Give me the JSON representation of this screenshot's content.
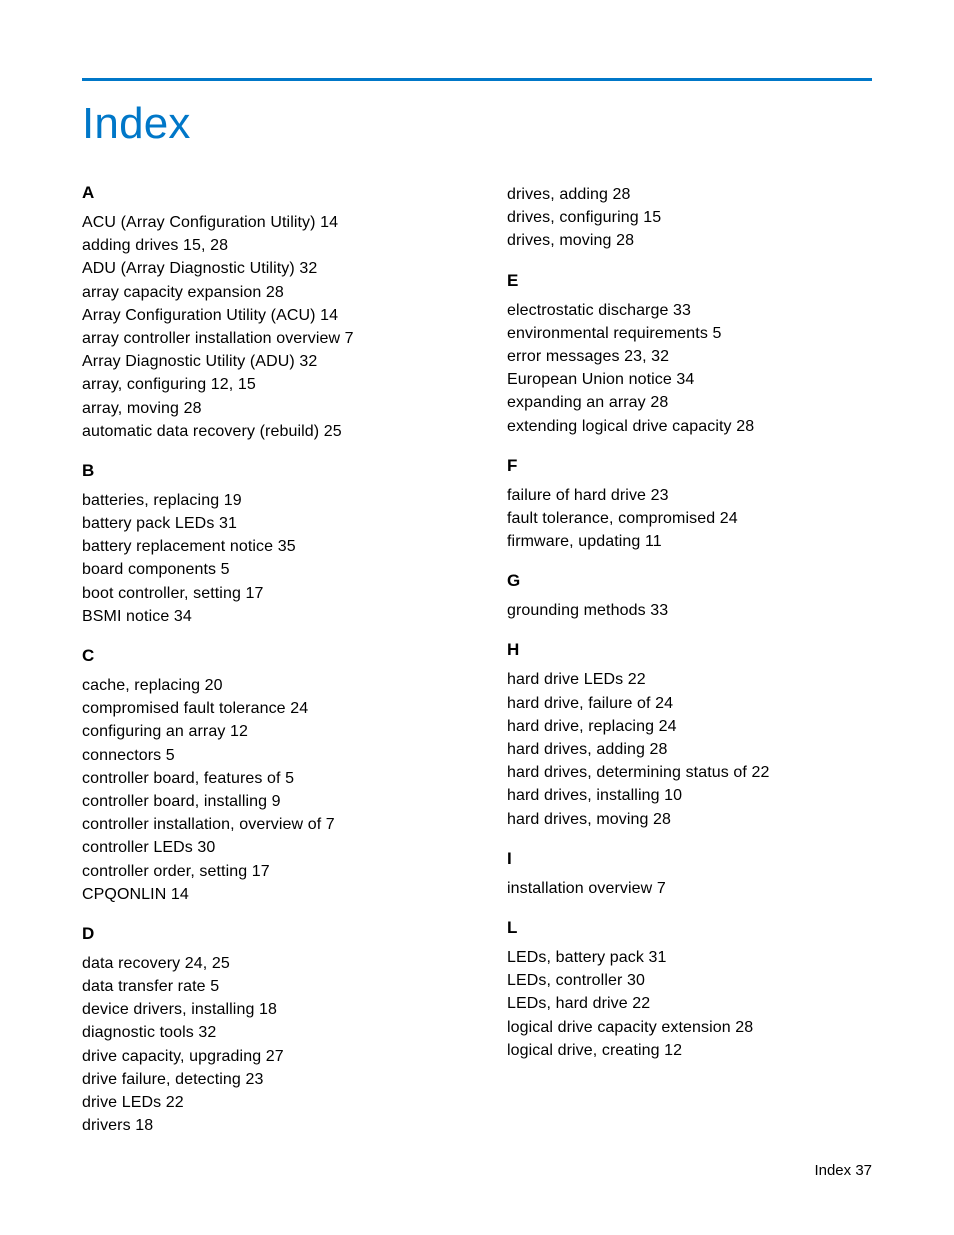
{
  "title": "Index",
  "footer": {
    "label": "Index",
    "page": "37"
  },
  "left": [
    {
      "head": "A",
      "entries": [
        "ACU (Array Configuration Utility)   14",
        "adding drives   15, 28",
        "ADU (Array Diagnostic Utility)   32",
        "array capacity expansion   28",
        "Array Configuration Utility (ACU)   14",
        "array controller installation overview   7",
        "Array Diagnostic Utility (ADU)   32",
        "array, configuring   12, 15",
        "array, moving   28",
        "automatic data recovery (rebuild)   25"
      ]
    },
    {
      "head": "B",
      "entries": [
        "batteries, replacing   19",
        "battery pack LEDs   31",
        "battery replacement notice   35",
        "board components   5",
        "boot controller, setting   17",
        "BSMI notice   34"
      ]
    },
    {
      "head": "C",
      "entries": [
        "cache, replacing   20",
        "compromised fault tolerance   24",
        "configuring an array   12",
        "connectors   5",
        "controller board, features of   5",
        "controller board, installing   9",
        "controller installation, overview of   7",
        "controller LEDs   30",
        "controller order, setting   17",
        "CPQONLIN   14"
      ]
    },
    {
      "head": "D",
      "entries": [
        "data recovery   24, 25",
        "data transfer rate   5",
        "device drivers, installing   18",
        "diagnostic tools   32",
        "drive capacity, upgrading   27",
        "drive failure, detecting   23",
        "drive LEDs   22",
        "drivers   18"
      ]
    }
  ],
  "right": [
    {
      "head": "",
      "entries": [
        "drives, adding   28",
        "drives, configuring   15",
        "drives, moving   28"
      ]
    },
    {
      "head": "E",
      "entries": [
        "electrostatic discharge   33",
        "environmental requirements   5",
        "error messages   23, 32",
        "European Union notice   34",
        "expanding an array   28",
        "extending logical drive capacity   28"
      ]
    },
    {
      "head": "F",
      "entries": [
        "failure of hard drive   23",
        "fault tolerance, compromised   24",
        "firmware, updating   11"
      ]
    },
    {
      "head": "G",
      "entries": [
        "grounding methods   33"
      ]
    },
    {
      "head": "H",
      "entries": [
        "hard drive LEDs   22",
        "hard drive, failure of   24",
        "hard drive, replacing   24",
        "hard drives, adding   28",
        "hard drives, determining status of   22",
        "hard drives, installing   10",
        "hard drives, moving   28"
      ]
    },
    {
      "head": "I",
      "entries": [
        "installation overview   7"
      ]
    },
    {
      "head": "L",
      "entries": [
        "LEDs, battery pack   31",
        "LEDs, controller   30",
        "LEDs, hard drive   22",
        "logical drive capacity extension   28",
        "logical drive, creating   12"
      ]
    }
  ]
}
